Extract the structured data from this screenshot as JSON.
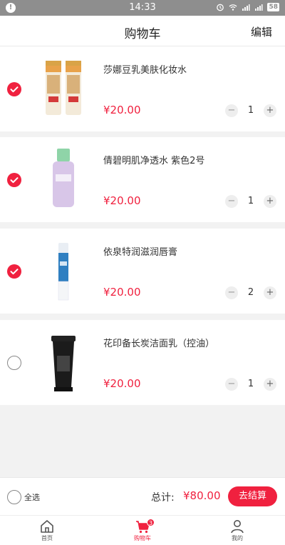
{
  "status_bar": {
    "time": "14:33",
    "battery": "58"
  },
  "header": {
    "title": "购物车",
    "edit_label": "编辑"
  },
  "cart": {
    "items": [
      {
        "name": "莎娜豆乳美肤化妆水",
        "price": "¥20.00",
        "quantity": "1",
        "selected": true,
        "icon": "toner-bottles-image"
      },
      {
        "name": "倩碧明肌净透水 紫色2号",
        "price": "¥20.00",
        "quantity": "1",
        "selected": true,
        "icon": "clarifying-lotion-image"
      },
      {
        "name": "依泉特润滋润唇膏",
        "price": "¥20.00",
        "quantity": "2",
        "selected": true,
        "icon": "lip-balm-image"
      },
      {
        "name": "花印备长炭洁面乳（控油）",
        "price": "¥20.00",
        "quantity": "1",
        "selected": false,
        "icon": "face-wash-tube-image"
      }
    ],
    "stepper": {
      "minus": "−",
      "plus": "+"
    }
  },
  "footer": {
    "select_all_label": "全选",
    "total_label": "总计:",
    "total_value": "¥80.00",
    "checkout_label": "去结算"
  },
  "tabbar": {
    "tabs": [
      {
        "label": "首页",
        "icon": "home-icon",
        "active": false
      },
      {
        "label": "购物车",
        "icon": "cart-icon",
        "active": true,
        "badge": "3"
      },
      {
        "label": "我的",
        "icon": "user-icon",
        "active": false
      }
    ]
  },
  "colors": {
    "accent": "#f0213f",
    "background": "#f2f2f2"
  }
}
